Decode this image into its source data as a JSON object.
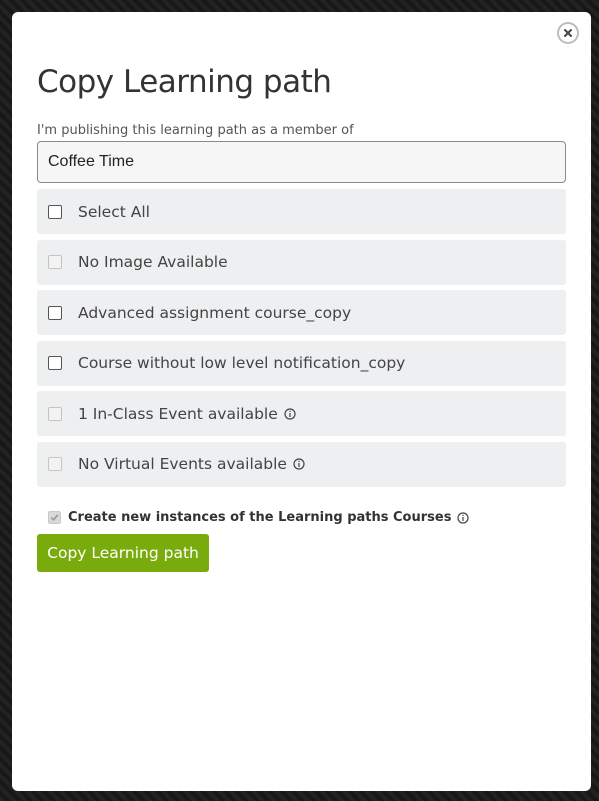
{
  "dialog": {
    "title": "Copy Learning path",
    "close_icon": "close-icon"
  },
  "member": {
    "label": "I'm publishing this learning path as a member of",
    "value": "Coffee Time"
  },
  "options": [
    {
      "label": "Select All",
      "enabled": true,
      "checked": false,
      "info": false
    },
    {
      "label": "No Image Available",
      "enabled": false,
      "checked": false,
      "info": false
    },
    {
      "label": "Advanced assignment course_copy",
      "enabled": true,
      "checked": false,
      "info": false
    },
    {
      "label": "Course without low level notification_copy",
      "enabled": true,
      "checked": false,
      "info": false
    },
    {
      "label": "1 In-Class Event available",
      "enabled": false,
      "checked": false,
      "info": true
    },
    {
      "label": "No Virtual Events available",
      "enabled": false,
      "checked": false,
      "info": true
    }
  ],
  "create_instances": {
    "label": "Create new instances of the Learning paths Courses",
    "checked": true,
    "enabled": false
  },
  "copy_button": {
    "label": "Copy Learning path",
    "color": "#7aab0c"
  }
}
